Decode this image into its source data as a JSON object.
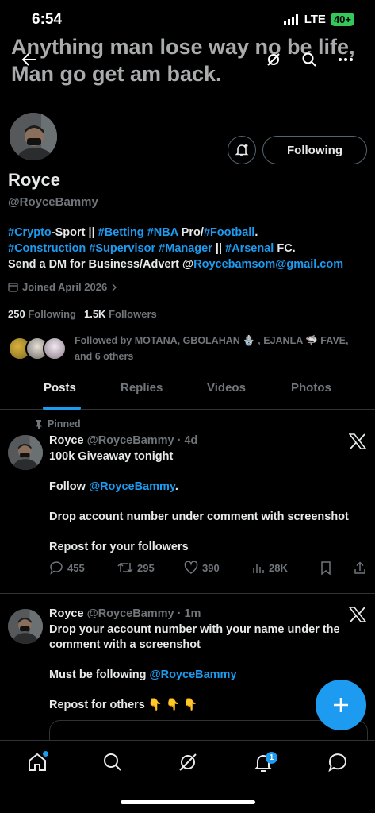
{
  "status_bar": {
    "time": "6:54",
    "network": "LTE",
    "battery": "40+"
  },
  "header": {
    "banner_line1": "Anything man lose way no be life,",
    "banner_line2": "Man go get am back."
  },
  "profile": {
    "name": "Royce",
    "handle": "@RoyceBammy",
    "follow_button": "Following",
    "bio": {
      "line1": [
        {
          "text": "#Crypto",
          "link": true
        },
        {
          "text": "-Sport || ",
          "link": false
        },
        {
          "text": "#Betting",
          "link": true
        },
        {
          "text": " ",
          "link": false
        },
        {
          "text": "#NBA",
          "link": true
        },
        {
          "text": " Pro/",
          "link": false
        },
        {
          "text": "#Football",
          "link": true
        },
        {
          "text": ".",
          "link": false
        }
      ],
      "line2": [
        {
          "text": "#Construction",
          "link": true
        },
        {
          "text": " ",
          "link": false
        },
        {
          "text": "#Supervisor",
          "link": true
        },
        {
          "text": " ",
          "link": false
        },
        {
          "text": "#Manager",
          "link": true
        },
        {
          "text": " || ",
          "link": false
        },
        {
          "text": "#Arsenal",
          "link": true
        },
        {
          "text": " FC.",
          "link": false
        }
      ],
      "line3": [
        {
          "text": "Send a DM for Business/Advert @",
          "link": false
        },
        {
          "text": "Roycebamsom@gmail.com",
          "link": true
        }
      ]
    },
    "joined": "Joined April 2026",
    "following_count": "250",
    "following_label": "Following",
    "followers_count": "1.5K",
    "followers_label": "Followers",
    "followed_by_line1": "Followed by MOTANA, GBOLAHAN 🪬 , EJANLA 🦈 FAVE,",
    "followed_by_line2": "and 6 others"
  },
  "tabs": [
    "Posts",
    "Replies",
    "Videos",
    "Photos"
  ],
  "posts": [
    {
      "pinned_label": "Pinned",
      "name": "Royce",
      "handle": "@RoyceBammy",
      "time": "· 4d",
      "line1": "100k Giveaway tonight",
      "line2_prefix": "Follow ",
      "line2_mention": "@RoyceBammy",
      "line2_suffix": ".",
      "line3": "Drop account number under comment with screenshot",
      "line4": "Repost for your followers",
      "replies": "455",
      "reposts": "295",
      "likes": "390",
      "views": "28K"
    },
    {
      "name": "Royce",
      "handle": "@RoyceBammy",
      "time": "· 1m",
      "line1": "Drop your account number with your name under the",
      "line2": "comment with a screenshot",
      "line3_prefix": "Must be following ",
      "line3_mention": "@RoyceBammy",
      "line4": "Repost for others 👇 👇 👇"
    }
  ],
  "bottom_nav": {
    "notifications_badge": "1"
  },
  "colors": {
    "accent": "#1d9bf0",
    "background": "#000000",
    "muted": "#71767b"
  }
}
